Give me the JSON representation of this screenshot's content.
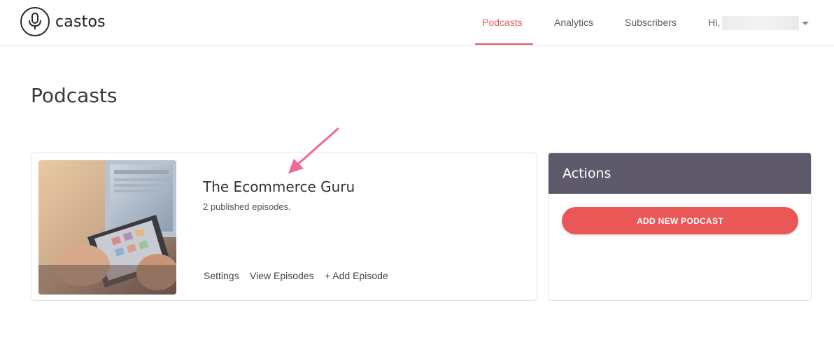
{
  "brand": {
    "name": "castos",
    "icon": "microphone-icon"
  },
  "nav": {
    "items": [
      {
        "label": "Podcasts",
        "active": true
      },
      {
        "label": "Analytics",
        "active": false
      },
      {
        "label": "Subscribers",
        "active": false
      }
    ],
    "greeting": "Hi,",
    "accent_color": "#e35d5d"
  },
  "page": {
    "title": "Podcasts"
  },
  "podcast": {
    "title": "The Ecommerce Guru",
    "episodes_text": "2 published episodes.",
    "links": {
      "settings": "Settings",
      "view_episodes": "View Episodes",
      "add_episode": "+ Add Episode"
    }
  },
  "actions": {
    "heading": "Actions",
    "add_button": "ADD NEW PODCAST",
    "header_color": "#5f5a6b",
    "button_color": "#e95757"
  },
  "annotation": {
    "arrow_color": "#f0679a"
  }
}
